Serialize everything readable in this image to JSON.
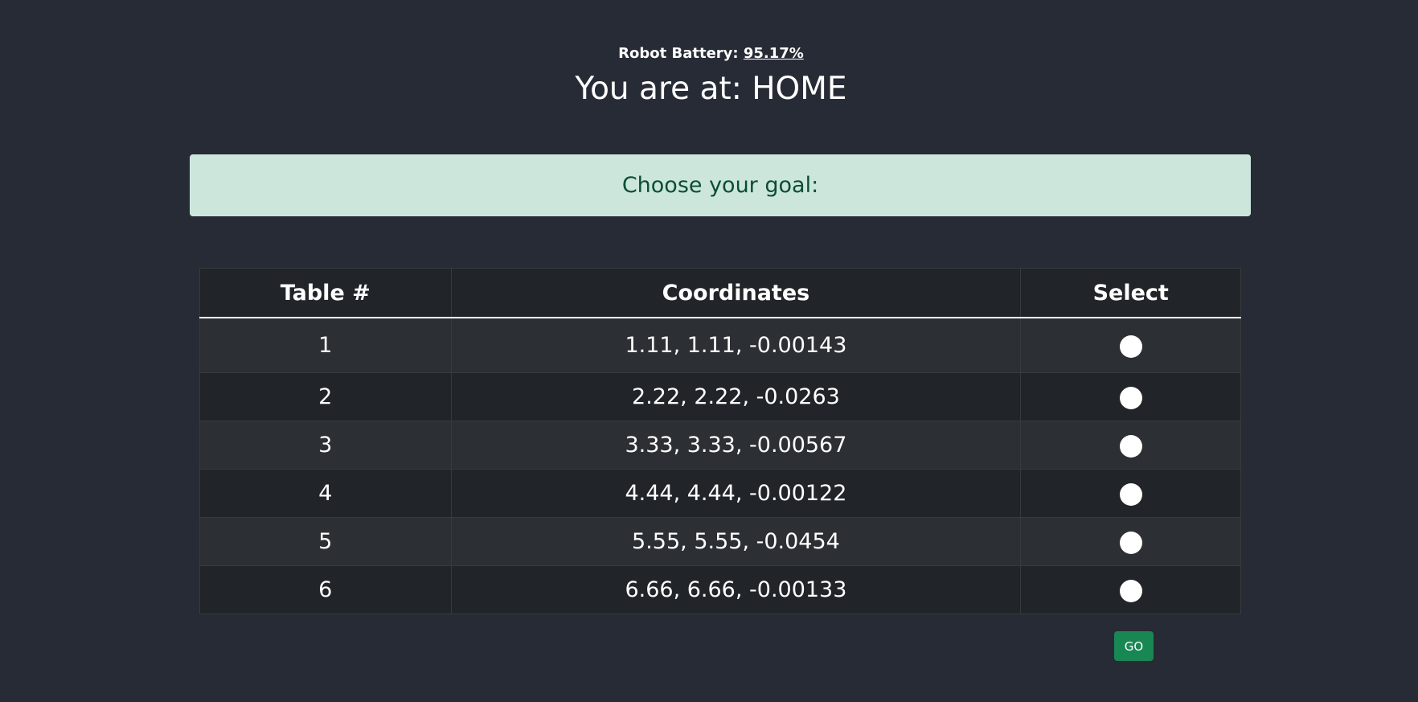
{
  "status": {
    "battery_label": "Robot Battery: ",
    "battery_value": "95.17%",
    "location_text": "You are at: HOME"
  },
  "goal_prompt": "Choose your goal:",
  "table": {
    "headers": [
      "Table #",
      "Coordinates",
      "Select"
    ],
    "rows": [
      {
        "number": "1",
        "coordinates": "1.11, 1.11, -0.00143"
      },
      {
        "number": "2",
        "coordinates": "2.22, 2.22, -0.0263"
      },
      {
        "number": "3",
        "coordinates": "3.33, 3.33, -0.00567"
      },
      {
        "number": "4",
        "coordinates": "4.44, 4.44, -0.00122"
      },
      {
        "number": "5",
        "coordinates": "5.55, 5.55, -0.0454"
      },
      {
        "number": "6",
        "coordinates": "6.66, 6.66, -0.00133"
      }
    ]
  },
  "go_button_label": "GO",
  "colors": {
    "background": "#272b35",
    "banner_background": "#cce6db",
    "banner_text": "#0b4d35",
    "go_button": "#198754"
  }
}
